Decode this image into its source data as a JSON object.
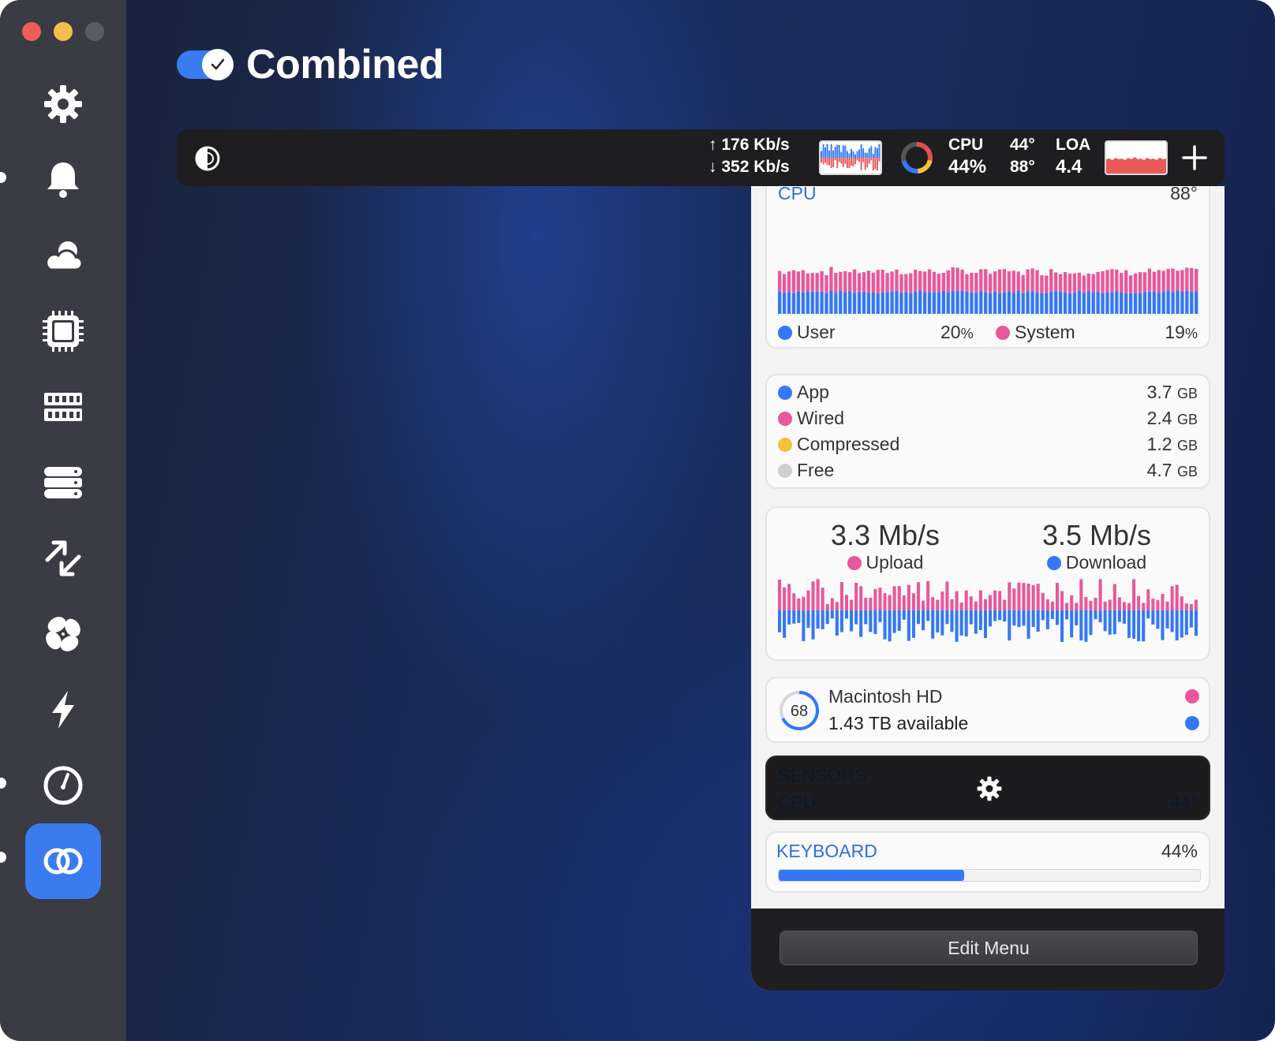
{
  "header": {
    "title": "Combined",
    "toggle_on": true
  },
  "sidebar": {
    "items": [
      {
        "icon": "gear-icon"
      },
      {
        "icon": "bell-icon"
      },
      {
        "icon": "cloud-sun-icon"
      },
      {
        "icon": "cpu-chip-icon"
      },
      {
        "icon": "memory-icon"
      },
      {
        "icon": "disk-stack-icon"
      },
      {
        "icon": "network-arrows-icon"
      },
      {
        "icon": "fan-icon"
      },
      {
        "icon": "lightning-icon"
      },
      {
        "icon": "gauge-icon"
      },
      {
        "icon": "combined-rings-icon",
        "active": true
      }
    ]
  },
  "menubar": {
    "upload": "176 Kb/s",
    "download": "352 Kb/s",
    "cpu_label": "CPU",
    "cpu_value": "44%",
    "temp_top": "44°",
    "temp_bottom": "88°",
    "load_label": "LOA",
    "load_value": "4.4"
  },
  "cpu_card": {
    "title": "CPU",
    "temp": "88°",
    "user_label": "User",
    "user_value": "20",
    "user_unit": "%",
    "system_label": "System",
    "system_value": "19",
    "system_unit": "%"
  },
  "memory_card": {
    "rows": [
      {
        "label": "App",
        "value": "3.7",
        "unit": "GB",
        "color": "#3478f6"
      },
      {
        "label": "Wired",
        "value": "2.4",
        "unit": "GB",
        "color": "#e8589a"
      },
      {
        "label": "Compressed",
        "value": "1.2",
        "unit": "GB",
        "color": "#f5c13e"
      },
      {
        "label": "Free",
        "value": "4.7",
        "unit": "GB",
        "color": "#cfcfd2"
      }
    ]
  },
  "network_card": {
    "upload_value": "3.3 Mb/s",
    "upload_label": "Upload",
    "download_value": "3.5 Mb/s",
    "download_label": "Download"
  },
  "disk_card": {
    "percent": "68",
    "name": "Macintosh HD",
    "available": "1.43 TB available"
  },
  "sensors_card": {
    "title": "SENSORS",
    "sensor_label": "CPU",
    "sensor_value": "44°"
  },
  "keyboard_card": {
    "title": "KEYBOARD",
    "value": "44%",
    "level": 0.44
  },
  "footer": {
    "edit_label": "Edit Menu"
  },
  "colors": {
    "accent": "#3478f6",
    "pink": "#e8589a",
    "yellow": "#f5c13e"
  }
}
